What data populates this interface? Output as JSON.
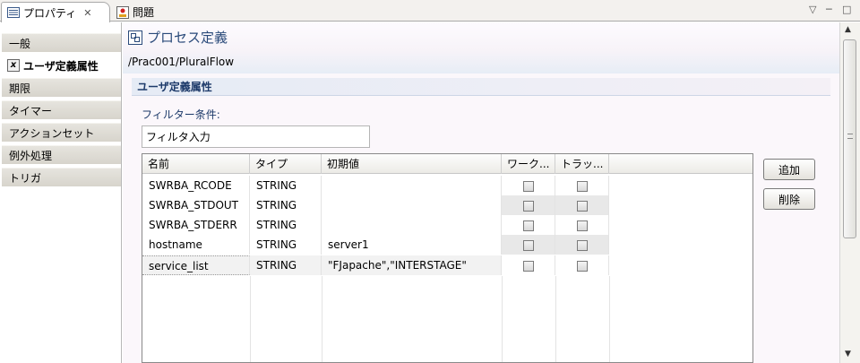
{
  "tabs": {
    "properties_label": "プロパティ",
    "problems_label": "問題",
    "close_glyph": "✕"
  },
  "view_controls": {
    "menu_glyph": "▽",
    "minimize_glyph": "─",
    "maximize_glyph": "□"
  },
  "nav": {
    "items": [
      {
        "label": "一般"
      },
      {
        "label": "ユーザ定義属性",
        "selected": true
      },
      {
        "label": "期限"
      },
      {
        "label": "タイマー"
      },
      {
        "label": "アクションセット"
      },
      {
        "label": "例外処理"
      },
      {
        "label": "トリガ"
      }
    ]
  },
  "header": {
    "title": "プロセス定義",
    "path": "/Prac001/PluralFlow"
  },
  "section": {
    "title": "ユーザ定義属性"
  },
  "filter": {
    "label": "フィルター条件:",
    "value": "フィルタ入力"
  },
  "table": {
    "columns": [
      "名前",
      "タイプ",
      "初期値",
      "ワーク...",
      "トラッ..."
    ],
    "rows": [
      {
        "name": "SWRBA_RCODE",
        "type": "STRING",
        "initial": "",
        "workflow": false,
        "tracking": false
      },
      {
        "name": "SWRBA_STDOUT",
        "type": "STRING",
        "initial": "",
        "workflow": false,
        "tracking": false
      },
      {
        "name": "SWRBA_STDERR",
        "type": "STRING",
        "initial": "",
        "workflow": false,
        "tracking": false
      },
      {
        "name": "hostname",
        "type": "STRING",
        "initial": "server1",
        "workflow": false,
        "tracking": false
      },
      {
        "name": "service_list",
        "type": "STRING",
        "initial": "\"FJapache\",\"INTERSTAGE\"",
        "workflow": false,
        "tracking": false,
        "selected": true
      }
    ]
  },
  "buttons": {
    "add_label": "追加",
    "delete_label": "削除"
  },
  "scrollbar": {
    "up_glyph": "▲",
    "down_glyph": "▼"
  }
}
